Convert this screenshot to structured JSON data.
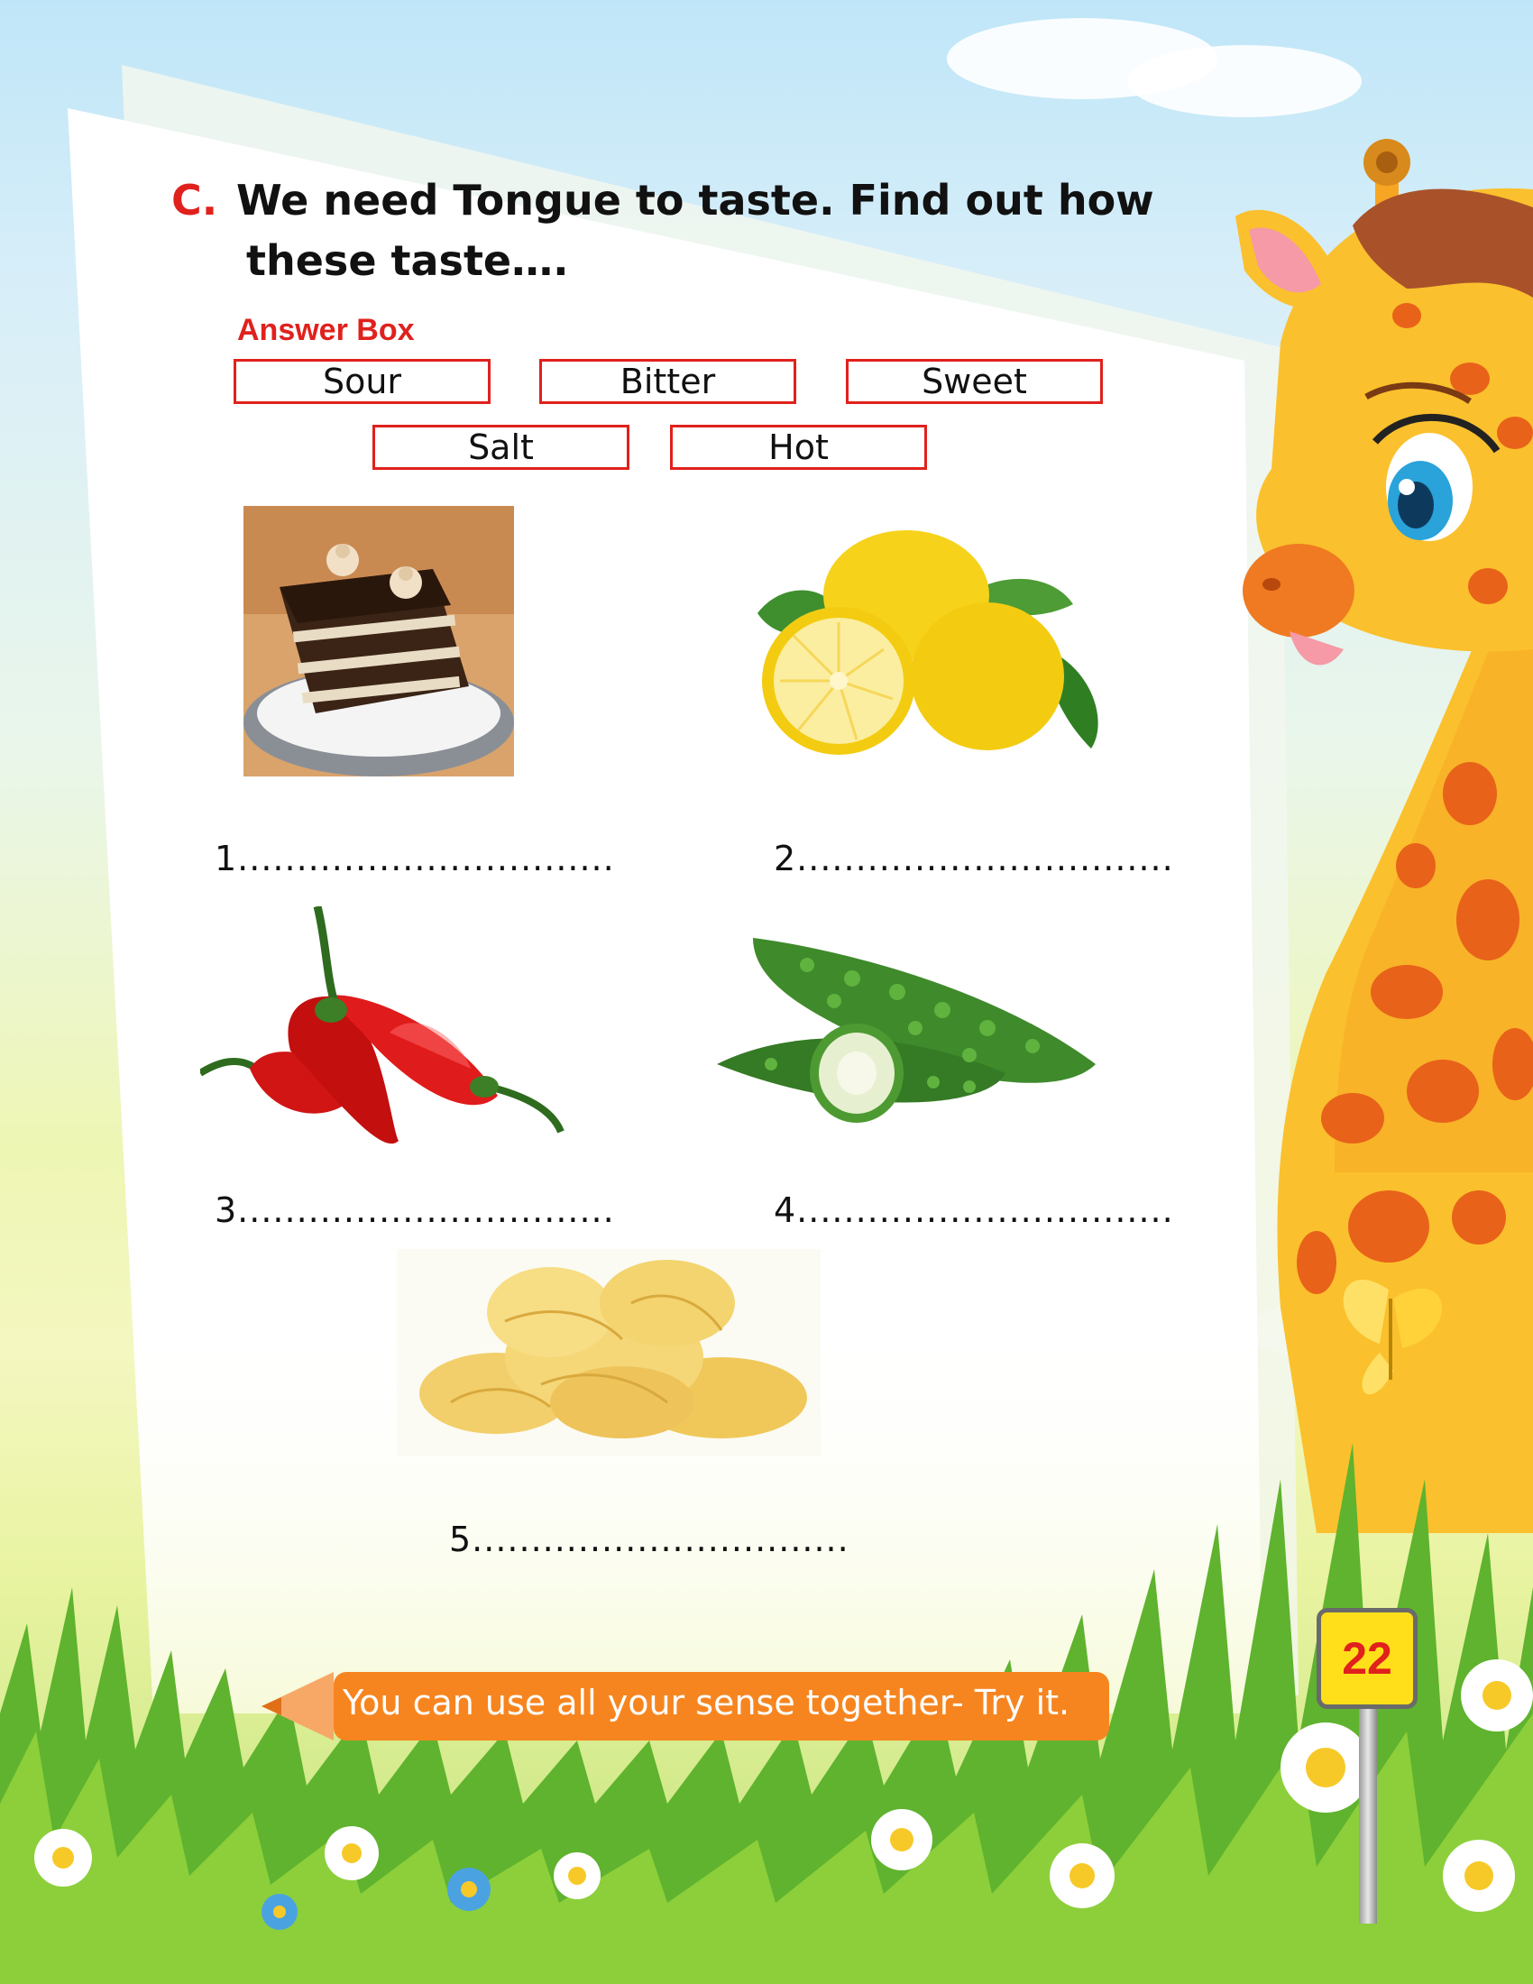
{
  "question": {
    "letter": "C.",
    "line1": "We need Tongue to taste. Find out how",
    "line2": "these taste…."
  },
  "answer_box": {
    "title": "Answer Box",
    "options": [
      "Sour",
      "Bitter",
      "Sweet",
      "Salt",
      "Hot"
    ]
  },
  "items": [
    {
      "label": "1................................",
      "image": "chocolate-cake"
    },
    {
      "label": "2................................",
      "image": "lemons"
    },
    {
      "label": "3................................",
      "image": "red-chillies"
    },
    {
      "label": "4................................",
      "image": "bitter-gourd"
    },
    {
      "label": "5................................",
      "image": "potato-chips"
    }
  ],
  "tip": "You can use all your sense together- Try it.",
  "page_number": "22",
  "colors": {
    "accent_red": "#e0211d",
    "tip_orange": "#f7851f",
    "page_badge_yellow": "#ffdf19",
    "giraffe_yellow": "#fbc02d",
    "giraffe_spots": "#e8621a"
  }
}
